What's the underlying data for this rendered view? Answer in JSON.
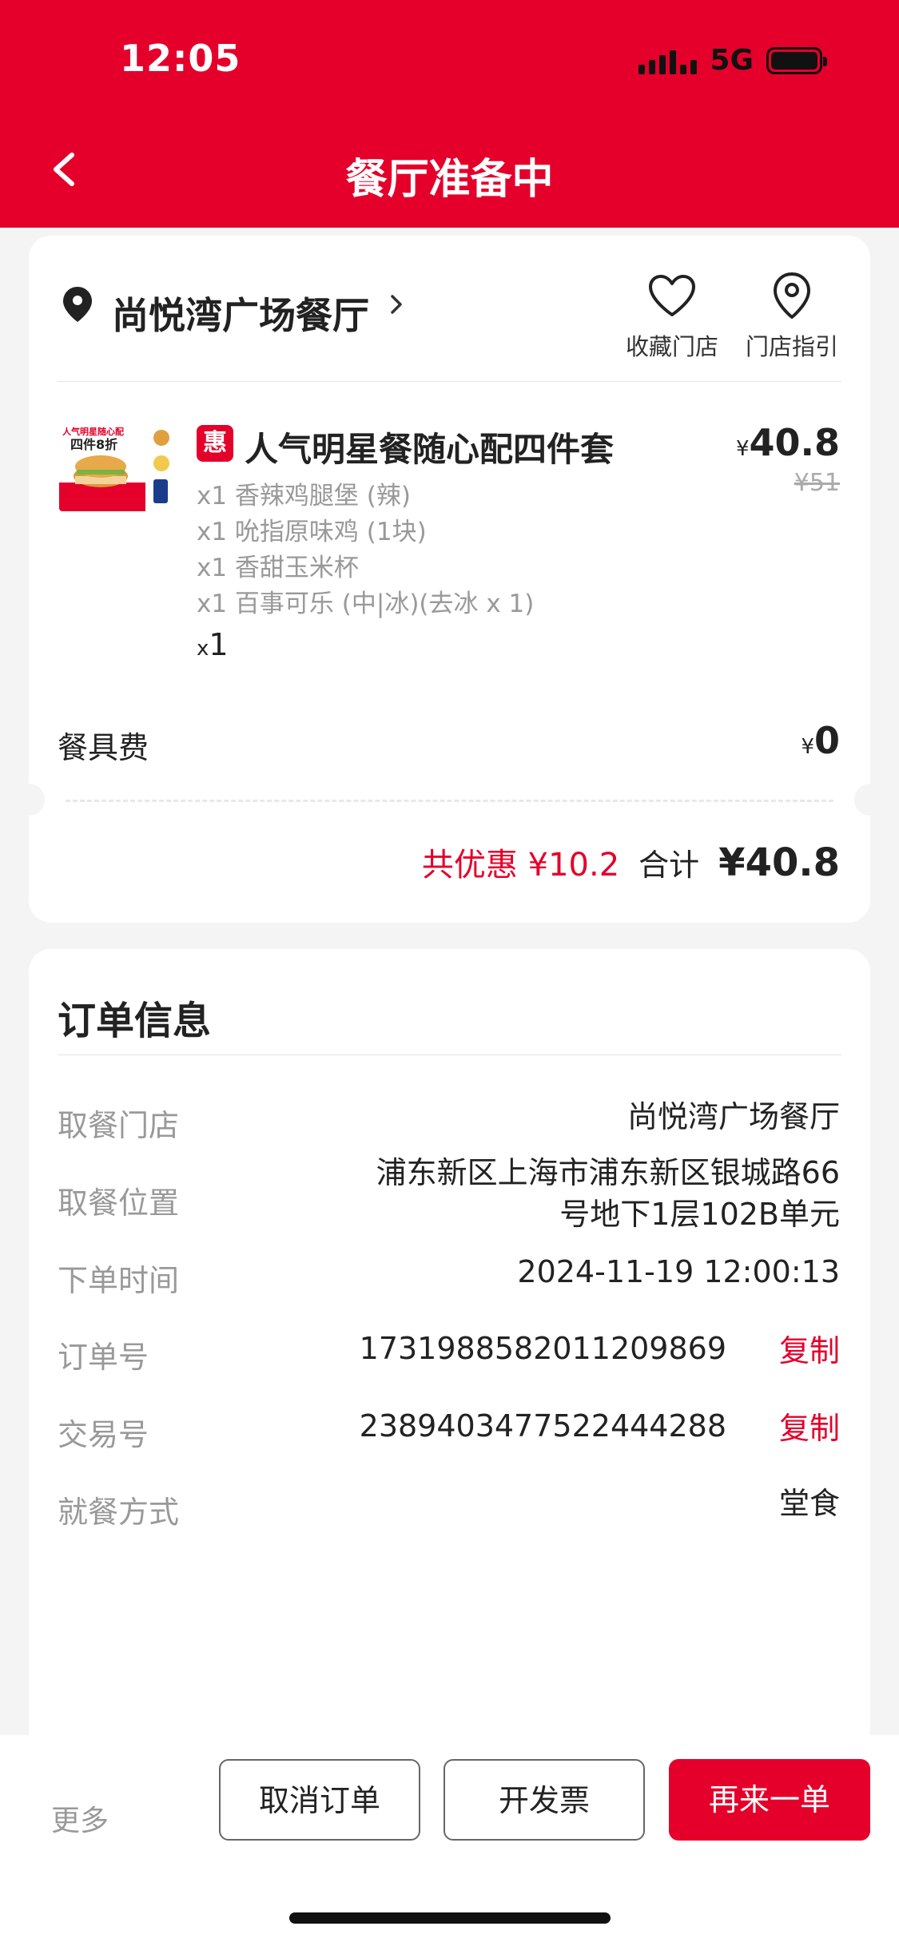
{
  "status_bar": {
    "time": "12:05",
    "network": "5G"
  },
  "header": {
    "title": "餐厅准备中"
  },
  "store": {
    "name": "尚悦湾广场餐厅",
    "favorite_label": "收藏门店",
    "guide_label": "门店指引"
  },
  "product": {
    "badge": "惠",
    "name": "人气明星餐随心配四件套",
    "price": "40.8",
    "price_currency": "¥",
    "original_price": "¥51",
    "image_text_1": "人气明星随心配",
    "image_text_2": "四件8折",
    "items": [
      "x1 香辣鸡腿堡 (辣)",
      "x1 吮指原味鸡 (1块)",
      "x1 香甜玉米杯",
      "x1 百事可乐 (中|冰)(去冰 x 1)"
    ],
    "qty_x": "x",
    "qty": "1"
  },
  "fee": {
    "label": "餐具费",
    "currency": "¥",
    "value": "0"
  },
  "totals": {
    "discount": "共优惠 ¥10.2",
    "sum_label": "合计",
    "sum_value": "¥40.8"
  },
  "order_info": {
    "title": "订单信息",
    "pickup_store_label": "取餐门店",
    "pickup_store": "尚悦湾广场餐厅",
    "pickup_location_label": "取餐位置",
    "pickup_location_line1": "浦东新区上海市浦东新区银城路66",
    "pickup_location_line2": "号地下1层102B单元",
    "order_time_label": "下单时间",
    "order_time": "2024-11-19 12:00:13",
    "order_no_label": "订单号",
    "order_no": "1731988582011209869",
    "trade_no_label": "交易号",
    "trade_no": "2389403477522444288",
    "copy_label": "复制",
    "dining_label": "就餐方式",
    "dining": "堂食"
  },
  "bottom": {
    "more": "更多",
    "cancel": "取消订单",
    "invoice": "开发票",
    "reorder": "再来一单"
  },
  "colors": {
    "brand": "#e4002b",
    "muted": "#999999"
  }
}
